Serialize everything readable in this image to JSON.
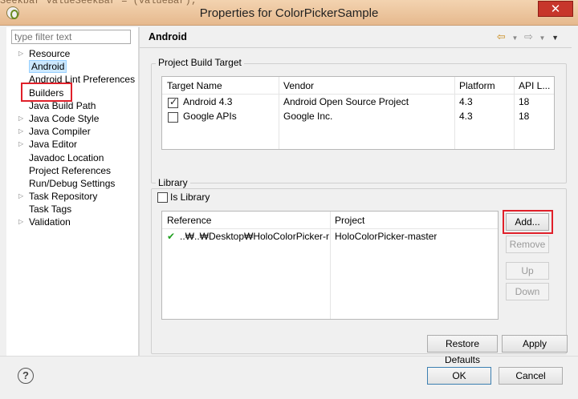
{
  "window": {
    "title": "Properties for ColorPickerSample",
    "behind_text": "Seekbar valueSeekBar = (valueBar);",
    "close_symbol": "✕"
  },
  "left": {
    "filter_placeholder": "type filter text",
    "tree": [
      {
        "label": "Resource",
        "expandable": true
      },
      {
        "label": "Android",
        "expandable": false,
        "selected": true
      },
      {
        "label": "Android Lint Preferences",
        "expandable": false
      },
      {
        "label": "Builders",
        "expandable": false
      },
      {
        "label": "Java Build Path",
        "expandable": false
      },
      {
        "label": "Java Code Style",
        "expandable": true
      },
      {
        "label": "Java Compiler",
        "expandable": true
      },
      {
        "label": "Java Editor",
        "expandable": true
      },
      {
        "label": "Javadoc Location",
        "expandable": false
      },
      {
        "label": "Project References",
        "expandable": false
      },
      {
        "label": "Run/Debug Settings",
        "expandable": false
      },
      {
        "label": "Task Repository",
        "expandable": true
      },
      {
        "label": "Task Tags",
        "expandable": false
      },
      {
        "label": "Validation",
        "expandable": true
      }
    ]
  },
  "page": {
    "title": "Android",
    "nav": {
      "back": "⇦",
      "forward": "⇨",
      "menu": "▼"
    }
  },
  "build_target": {
    "legend": "Project Build Target",
    "headers": [
      "Target Name",
      "Vendor",
      "Platform",
      "API L..."
    ],
    "rows": [
      {
        "checked": true,
        "name": "Android 4.3",
        "vendor": "Android Open Source Project",
        "platform": "4.3",
        "api": "18"
      },
      {
        "checked": false,
        "name": "Google APIs",
        "vendor": "Google Inc.",
        "platform": "4.3",
        "api": "18"
      }
    ]
  },
  "library": {
    "legend": "Library",
    "is_library_label": "Is Library",
    "is_library_checked": false,
    "headers": [
      "Reference",
      "Project"
    ],
    "rows": [
      {
        "status": "✔",
        "reference": "..₩..₩Desktop₩HoloColorPicker-mas...",
        "project": "HoloColorPicker-master"
      }
    ],
    "buttons": {
      "add": "Add...",
      "remove": "Remove",
      "up": "Up",
      "down": "Down"
    }
  },
  "actions": {
    "restore_defaults": "Restore Defaults",
    "apply": "Apply",
    "ok": "OK",
    "cancel": "Cancel",
    "help": "?"
  },
  "colors": {
    "highlight": "#e0202a",
    "check_green": "#20a020",
    "selection": "#cce8ff"
  }
}
